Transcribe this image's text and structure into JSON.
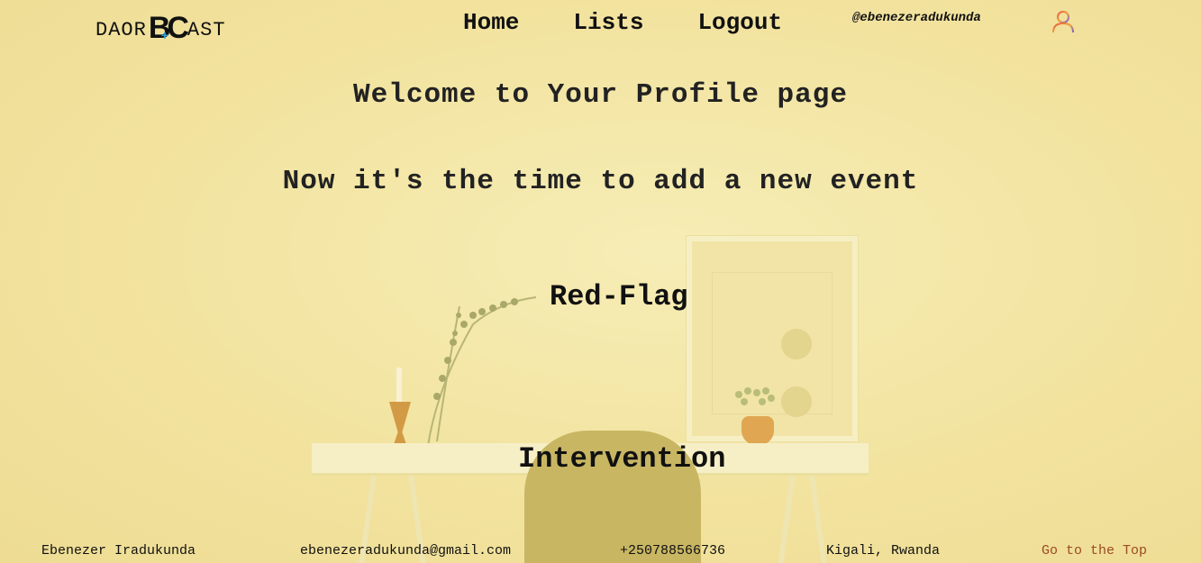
{
  "logo": {
    "left": "DAOR",
    "mark": "BC",
    "plus": "+",
    "right": "AST"
  },
  "nav": [
    {
      "label": "Home"
    },
    {
      "label": "Lists"
    },
    {
      "label": "Logout"
    }
  ],
  "user": {
    "handle": "@ebenezeradukunda",
    "icon": "user-icon"
  },
  "main": {
    "welcome": "Welcome to Your Profile page",
    "subtitle": "Now it's the time to add a new event",
    "options": [
      {
        "label": "Red-Flag"
      },
      {
        "label": "Intervention"
      }
    ]
  },
  "footer": {
    "name": "Ebenezer Iradukunda",
    "email": "ebenezeradukunda@gmail.com",
    "phone": "+250788566736",
    "location": "Kigali, Rwanda",
    "top_link": "Go to the Top"
  },
  "colors": {
    "background": "#f4e7a6",
    "logo_plus": "#2aa7e6",
    "top_link": "#9a4b25"
  }
}
